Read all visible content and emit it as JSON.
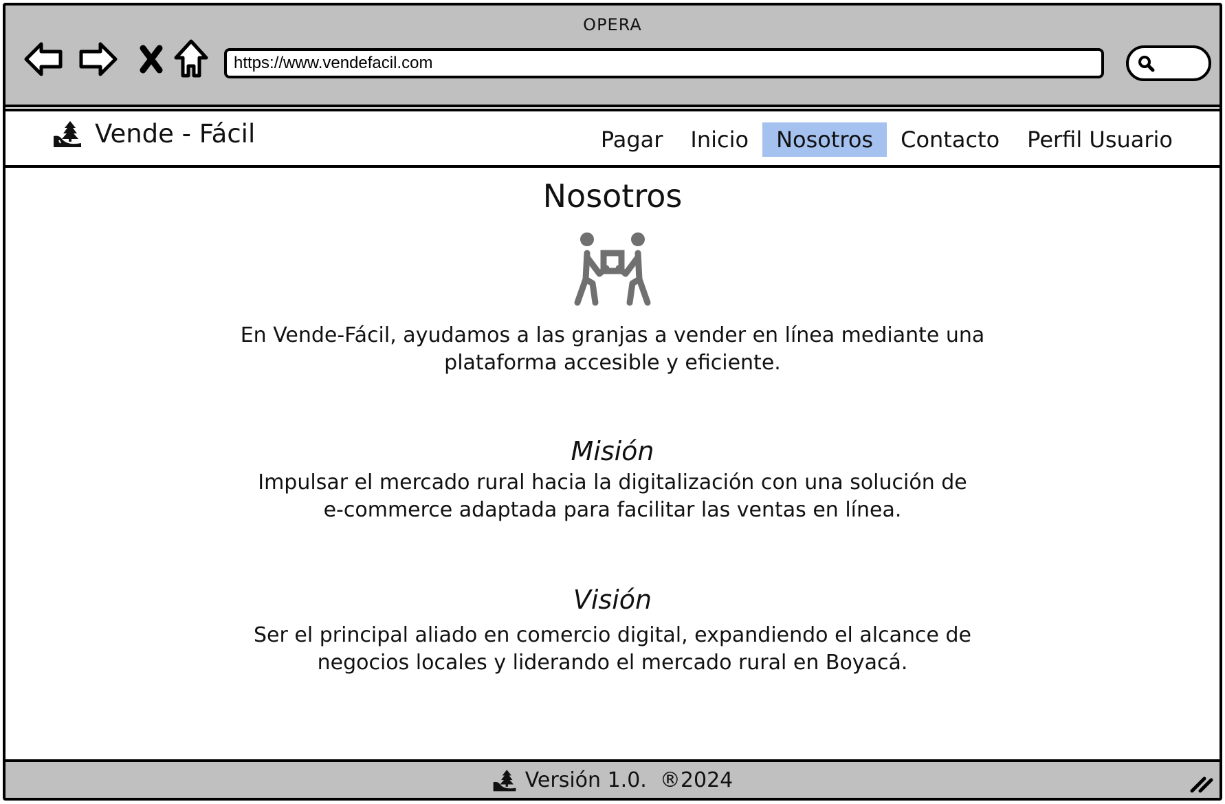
{
  "browser": {
    "title": "OPERA",
    "url": "https://www.vendefacil.com"
  },
  "header": {
    "brand": "Vende - Fácil",
    "menu": [
      {
        "label": "Pagar"
      },
      {
        "label": "Inicio"
      },
      {
        "label": "Nosotros",
        "active": true
      },
      {
        "label": "Contacto"
      },
      {
        "label": "Perfil Usuario"
      }
    ]
  },
  "main": {
    "title": "Nosotros",
    "intro": [
      "En Vende-Fácil, ayudamos a las granjas a vender en línea mediante una",
      "plataforma accesible y eficiente."
    ],
    "mission": {
      "heading": "Misión",
      "lines": [
        "Impulsar el mercado rural hacia la digitalización con una solución de",
        "e-commerce adaptada para facilitar las ventas en línea."
      ]
    },
    "vision": {
      "heading": "Visión",
      "lines": [
        "Ser el principal aliado en comercio digital, expandiendo el alcance de",
        "negocios locales y liderando el mercado rural en Boyacá."
      ]
    }
  },
  "footer": {
    "text": "Versión 1.0.  ®2024"
  },
  "colors": {
    "chrome": "#c0c0c0",
    "active_menu": "#a4c1f0",
    "icon_gray": "#707070"
  },
  "icons": [
    "back-arrow-icon",
    "forward-arrow-icon",
    "close-icon",
    "home-icon",
    "search-icon",
    "farm-logo-icon",
    "people-carrying-box-icon",
    "resize-grip-icon"
  ]
}
